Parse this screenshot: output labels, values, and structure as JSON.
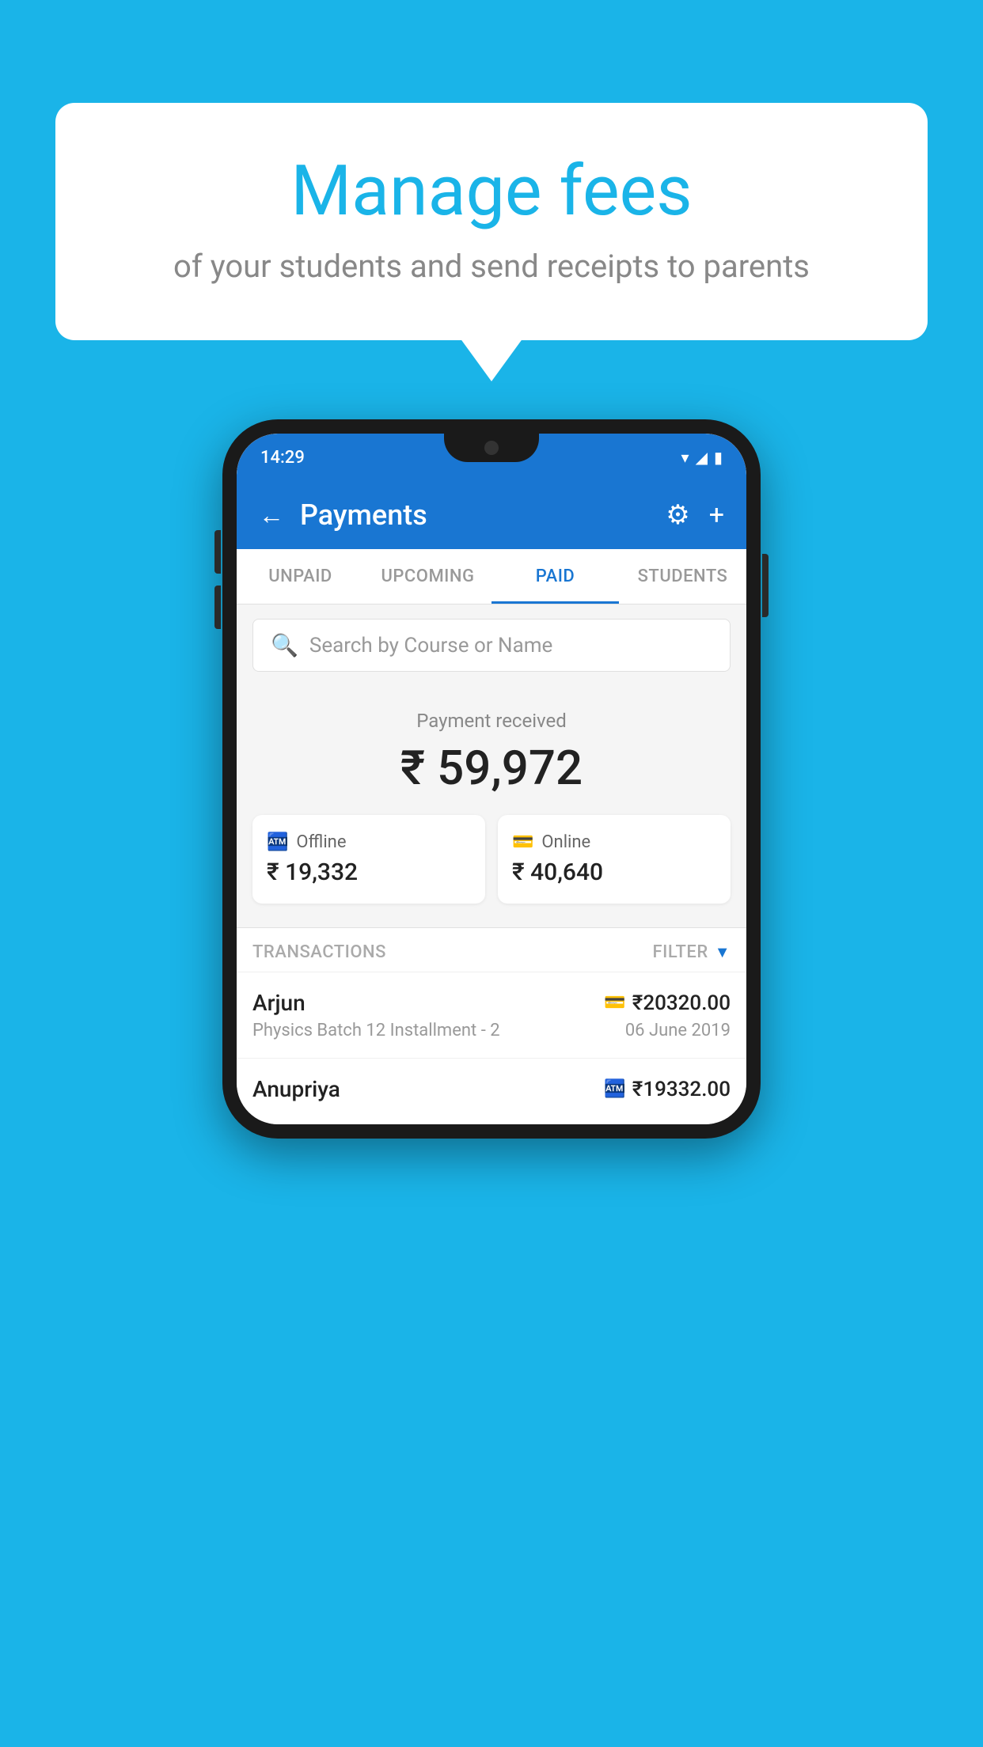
{
  "background": {
    "color": "#1ab4e8"
  },
  "speech_bubble": {
    "title": "Manage fees",
    "subtitle": "of your students and send receipts to parents"
  },
  "phone": {
    "status_bar": {
      "time": "14:29"
    },
    "header": {
      "back_label": "←",
      "title": "Payments",
      "gear_icon": "⚙",
      "plus_icon": "+"
    },
    "tabs": [
      {
        "label": "UNPAID",
        "active": false
      },
      {
        "label": "UPCOMING",
        "active": false
      },
      {
        "label": "PAID",
        "active": true
      },
      {
        "label": "STUDENTS",
        "active": false
      }
    ],
    "search": {
      "placeholder": "Search by Course or Name"
    },
    "payment_received": {
      "label": "Payment received",
      "amount": "₹ 59,972",
      "offline": {
        "label": "Offline",
        "amount": "₹ 19,332"
      },
      "online": {
        "label": "Online",
        "amount": "₹ 40,640"
      }
    },
    "transactions": {
      "header_label": "TRANSACTIONS",
      "filter_label": "FILTER",
      "rows": [
        {
          "name": "Arjun",
          "course": "Physics Batch 12 Installment - 2",
          "amount": "₹20320.00",
          "date": "06 June 2019",
          "payment_type": "online"
        },
        {
          "name": "Anupriya",
          "course": "",
          "amount": "₹19332.00",
          "date": "",
          "payment_type": "offline"
        }
      ]
    }
  }
}
